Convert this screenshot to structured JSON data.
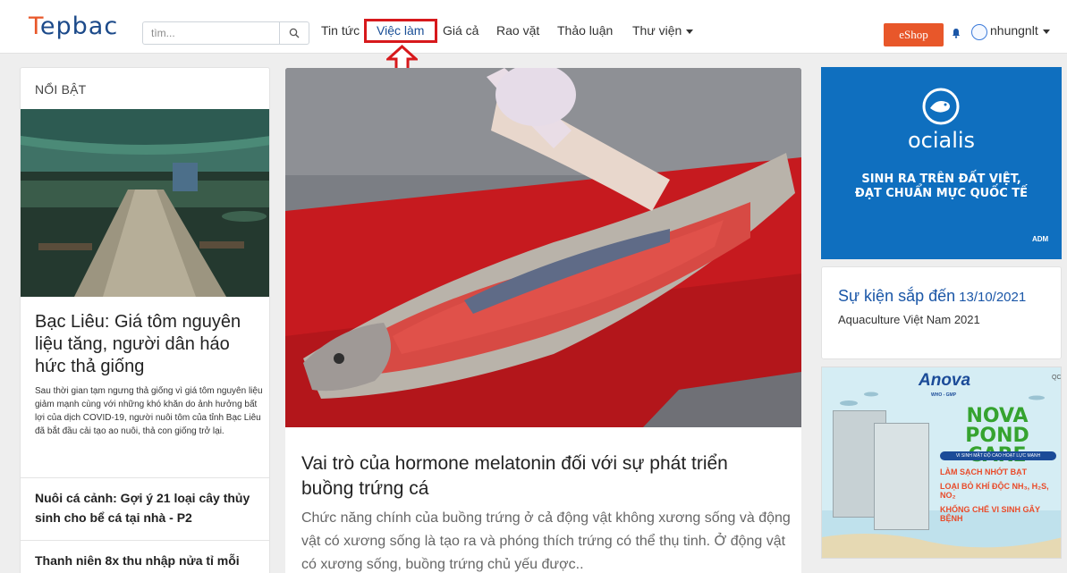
{
  "header": {
    "logo_prefix": "T",
    "logo_rest": "epbac",
    "search": {
      "placeholder": "tìm..."
    },
    "nav": [
      {
        "label": "Tin tức"
      },
      {
        "label": "Việc làm"
      },
      {
        "label": "Giá cả"
      },
      {
        "label": "Rao vặt"
      },
      {
        "label": "Thảo luận"
      },
      {
        "label": "Thư viện"
      }
    ],
    "eshop_label": "eShop",
    "username": "nhungnlt"
  },
  "featured": {
    "title": "NỔI BẬT",
    "main_article": {
      "title": "Bạc Liêu: Giá tôm nguyên liệu tăng, người dân háo hức thả giống",
      "description": "Sau thời gian tạm ngưng thả giống vì giá tôm nguyên liệu giảm mạnh cùng với những khó khăn do ảnh hưởng bất lợi của dịch COVID-19, người nuôi tôm của tỉnh Bạc Liêu đã bắt đầu cải tạo ao nuôi, thả con giống trở lại."
    },
    "links": [
      {
        "title": "Nuôi cá cảnh: Gợi ý 21 loại cây thủy sinh cho bể cá tại nhà - P2"
      },
      {
        "title": "Thanh niên 8x thu nhập nửa tỉ mỗi"
      }
    ]
  },
  "main_article": {
    "title": "Vai trò của hormone melatonin đối với sự phát triển buồng trứng cá",
    "description": "Chức năng chính của buồng trứng ở cả động vật không xương sống và động vật có xương sống là tạo ra và phóng thích trứng có thể thụ tinh. Ở động vật có xương sống, buồng trứng chủ yếu được.."
  },
  "ads": {
    "ocialis": {
      "brand": "ocialis",
      "slogan_line1": "SINH RA TRÊN ĐẤT VIỆT,",
      "slogan_line2": "ĐẠT CHUẨN MỰC QUỐC TẾ",
      "adm": "ADM"
    },
    "anova": {
      "brand": "Anova",
      "sub": "WHO - GMP",
      "qc": "QC",
      "product_line1": "NOVA",
      "product_line2": "POND CARE",
      "band": "VI SINH MẬT ĐỘ CAO HOẠT LỰC MẠNH",
      "points": [
        "LÀM SẠCH NHỚT BẠT",
        "LOẠI BỎ KHÍ ĐỘC NH₃, H₂S, NO₂",
        "KHỐNG CHẾ VI SINH GÂY BỆNH"
      ]
    }
  },
  "events": {
    "heading": "Sự kiện sắp đến",
    "date": "13/10/2021",
    "item": "Aquaculture Việt Nam 2021"
  },
  "colors": {
    "brand_blue": "#1c4a8a",
    "accent_orange": "#e8572a",
    "highlight_red": "#d7191c",
    "event_blue": "#1a56a7"
  }
}
